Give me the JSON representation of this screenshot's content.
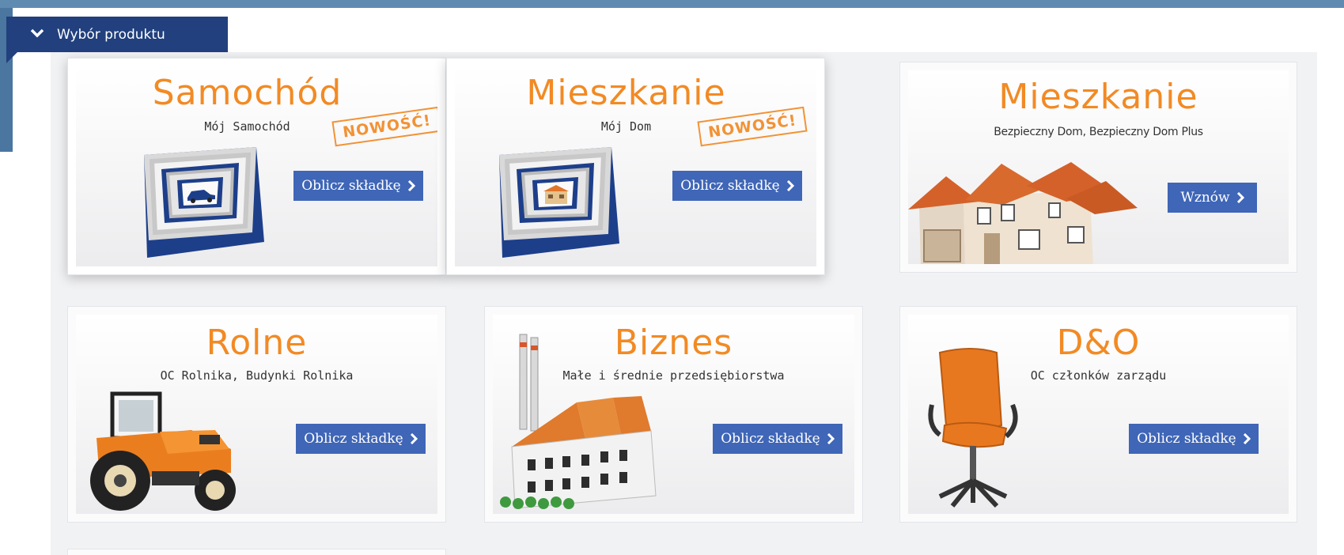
{
  "header": {
    "label": "Wybór produktu"
  },
  "products": [
    {
      "title": "Samochód",
      "subtitle": "Mój Samochód",
      "badge": "NOWOŚĆ!",
      "button": "Oblicz składkę"
    },
    {
      "title": "Mieszkanie",
      "subtitle": "Mój Dom",
      "badge": "NOWOŚĆ!",
      "button": "Oblicz składkę"
    },
    {
      "title": "Mieszkanie",
      "subtitle": "Bezpieczny Dom, Bezpieczny Dom Plus",
      "button": "Wznów"
    },
    {
      "title": "Rolne",
      "subtitle": "OC Rolnika, Budynki Rolnika",
      "button": "Oblicz składkę"
    },
    {
      "title": "Biznes",
      "subtitle": "Małe i średnie przedsiębiorstwa",
      "button": "Oblicz składkę"
    },
    {
      "title": "D&O",
      "subtitle": "OC członków zarządu",
      "button": "Oblicz składkę"
    }
  ],
  "colors": {
    "accent": "#f28a24",
    "button": "#3f66b7",
    "header": "#21407d",
    "background": "#5f8bb1"
  },
  "icons": [
    "chevron-down-icon",
    "chevron-right-icon",
    "car-box-image",
    "house-box-image",
    "house-image",
    "tractor-image",
    "factory-image",
    "office-chair-image"
  ]
}
